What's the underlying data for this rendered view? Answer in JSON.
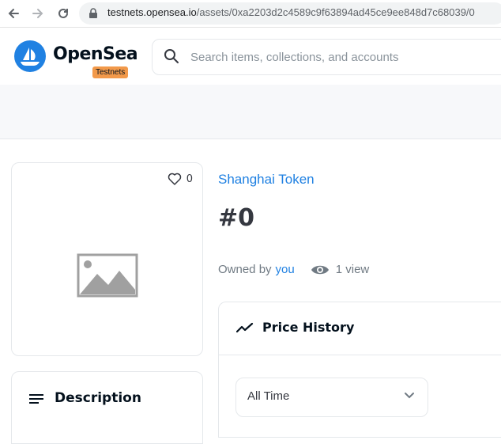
{
  "browser": {
    "url_host": "testnets.opensea.io",
    "url_path": "/assets/0xa2203d2c4589c9f63894ad45ce9ee848d7c68039/0"
  },
  "header": {
    "brand": "OpenSea",
    "badge": "Testnets",
    "search_placeholder": "Search items, collections, and accounts"
  },
  "asset": {
    "favorites_count": "0",
    "collection_name": "Shanghai Token",
    "title": "#0",
    "owned_by_label": "Owned by",
    "owner": "you",
    "views": "1 view"
  },
  "description": {
    "title": "Description"
  },
  "price_history": {
    "title": "Price History",
    "range_selected": "All Time"
  },
  "colors": {
    "accent": "#2081e2",
    "badge": "#f2994a",
    "text": "#04111d",
    "muted": "#707a83"
  }
}
